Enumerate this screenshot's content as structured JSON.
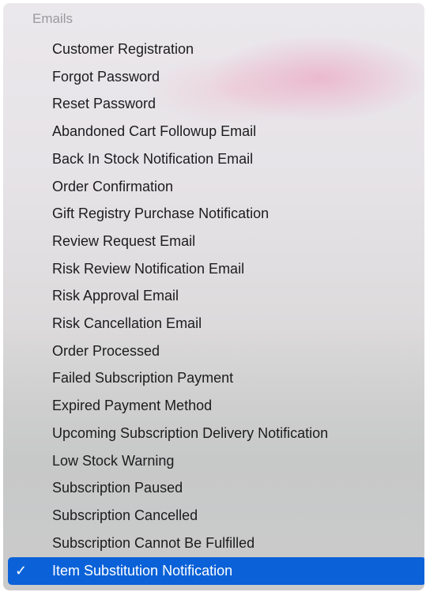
{
  "menu": {
    "section_header": "Emails",
    "items": [
      {
        "label": "Customer Registration",
        "selected": false
      },
      {
        "label": "Forgot Password",
        "selected": false
      },
      {
        "label": "Reset Password",
        "selected": false
      },
      {
        "label": "Abandoned Cart Followup Email",
        "selected": false
      },
      {
        "label": "Back In Stock Notification Email",
        "selected": false
      },
      {
        "label": "Order Confirmation",
        "selected": false
      },
      {
        "label": "Gift Registry Purchase Notification",
        "selected": false
      },
      {
        "label": "Review Request Email",
        "selected": false
      },
      {
        "label": "Risk Review Notification Email",
        "selected": false
      },
      {
        "label": "Risk Approval Email",
        "selected": false
      },
      {
        "label": "Risk Cancellation Email",
        "selected": false
      },
      {
        "label": "Order Processed",
        "selected": false
      },
      {
        "label": "Failed Subscription Payment",
        "selected": false
      },
      {
        "label": "Expired Payment Method",
        "selected": false
      },
      {
        "label": "Upcoming Subscription Delivery Notification",
        "selected": false
      },
      {
        "label": "Low Stock Warning",
        "selected": false
      },
      {
        "label": "Subscription Paused",
        "selected": false
      },
      {
        "label": "Subscription Cancelled",
        "selected": false
      },
      {
        "label": "Subscription Cannot Be Fulfilled",
        "selected": false
      },
      {
        "label": "Item Substitution Notification",
        "selected": true
      }
    ],
    "checkmark_glyph": "✓",
    "selection_color": "#0b62d8",
    "icons": [
      "check-icon"
    ]
  }
}
